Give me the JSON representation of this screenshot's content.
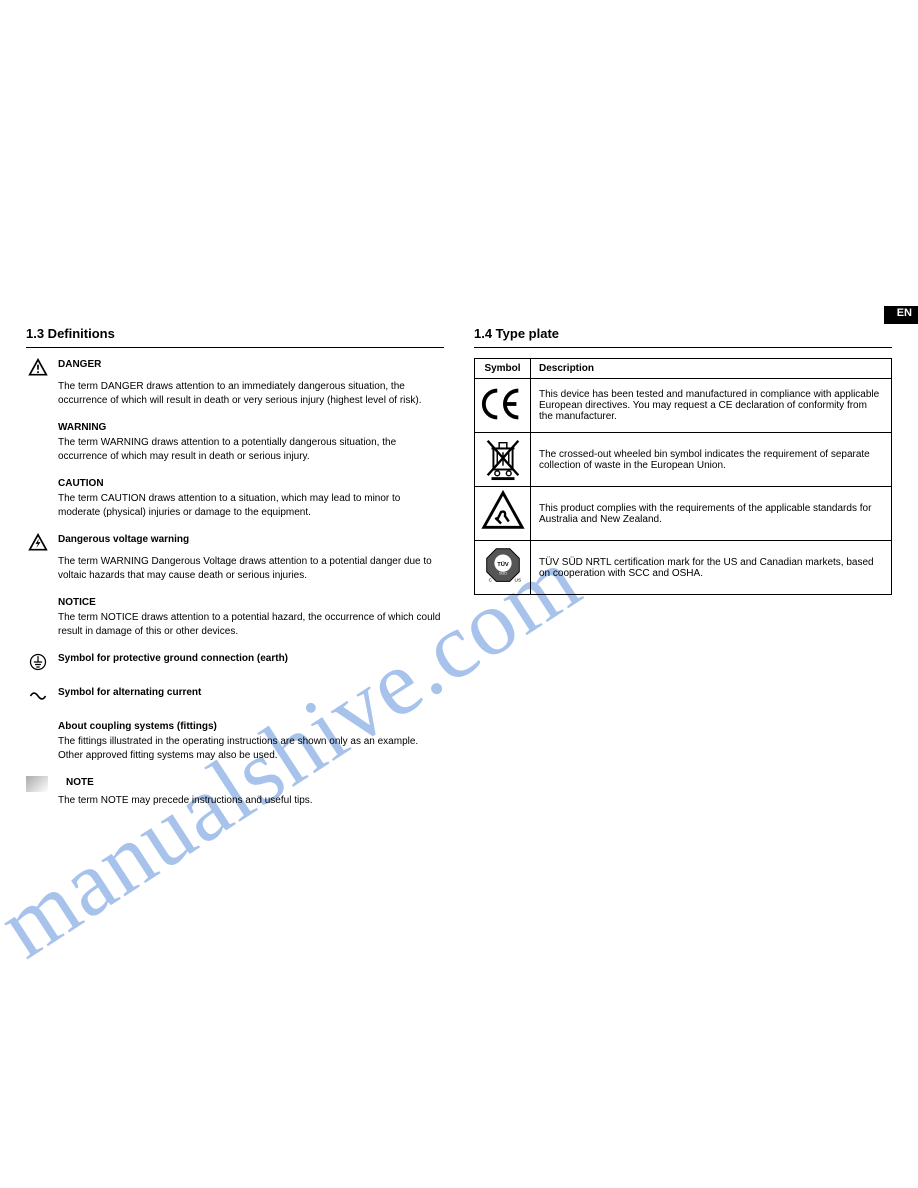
{
  "page_number_label": "EN",
  "watermark": "manualshive.com",
  "left": {
    "heading": "1.3 Definitions",
    "danger": {
      "term": "DANGER",
      "desc": "The term DANGER draws attention to an immediately dangerous situation, the occurrence of which will result in death or very serious injury (highest level of risk)."
    },
    "warning": {
      "term": "WARNING",
      "desc": "The term WARNING draws attention to a potentially dangerous situation, the occurrence of which may result in death or serious injury."
    },
    "caution": {
      "term": "CAUTION",
      "desc": "The term CAUTION draws attention to a situation, which may lead to minor to moderate (physical) injuries or damage to the equipment."
    },
    "voltage": {
      "term": "Dangerous voltage warning",
      "desc": "The term WARNING Dangerous Voltage draws attention to a potential danger due to voltaic hazards that may cause death or serious injuries."
    },
    "notice": {
      "term": "NOTICE",
      "desc": "The term NOTICE draws attention to a potential hazard, the occurrence of which could result in damage of this or other devices."
    },
    "ground": {
      "term": "Symbol for protective ground connection (earth)"
    },
    "ac": {
      "term": "Symbol for alternating current"
    },
    "fitting": {
      "term": "About coupling systems (fittings)",
      "desc": "The fittings illustrated in the operating instructions are shown only as an example. Other approved fitting systems may also be used."
    },
    "note": {
      "term": "NOTE",
      "desc": "The term NOTE may precede instructions and useful tips."
    }
  },
  "right": {
    "heading": "1.4 Type plate",
    "header_symbol": "Symbol",
    "header_desc": "Description",
    "ce": "This device has been tested and manufactured in compliance with applicable European directives. You may request a CE declaration of conformity from the manufacturer.",
    "weee": "The crossed-out wheeled bin symbol indicates the requirement of separate collection of waste in the European Union.",
    "rcm": "This product complies with the requirements of the applicable standards for Australia and New Zealand.",
    "tuv": "TÜV SÜD NRTL certification mark for the US and Canadian markets, based on cooperation with SCC and OSHA."
  }
}
